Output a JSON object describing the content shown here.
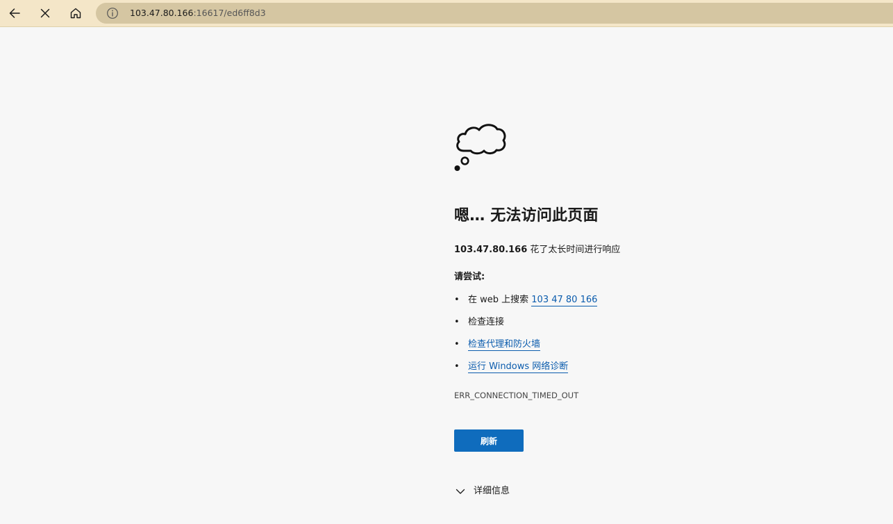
{
  "browser": {
    "back_icon": "arrow-left-icon",
    "stop_icon": "close-icon",
    "home_icon": "home-icon",
    "address": {
      "info_icon": "info-icon",
      "host": "103.47.80.166",
      "rest": ":16617/ed6ff8d3"
    }
  },
  "error_page": {
    "illustration": "thought-cloud-icon",
    "title": "嗯… 无法访问此页面",
    "description_host": "103.47.80.166",
    "description_text": " 花了太长时间进行响应",
    "try_heading": "请尝试:",
    "suggestions": [
      {
        "prefix": "在 web 上搜索 ",
        "link": "103 47 80 166"
      },
      {
        "prefix": "检查连接",
        "link": ""
      },
      {
        "prefix": "",
        "link": "检查代理和防火墙"
      },
      {
        "prefix": "",
        "link": "运行 Windows 网络诊断"
      }
    ],
    "bullet": "•",
    "error_code": "ERR_CONNECTION_TIMED_OUT",
    "refresh_label": "刷新",
    "details_label": "详细信息",
    "details_icon": "chevron-down-icon"
  },
  "colors": {
    "toolbar": "#f4e6c8",
    "address_bar": "#d5c6a2",
    "page_background": "#f7f7f7",
    "link": "#0b5cad",
    "button": "#0f6cbd"
  }
}
